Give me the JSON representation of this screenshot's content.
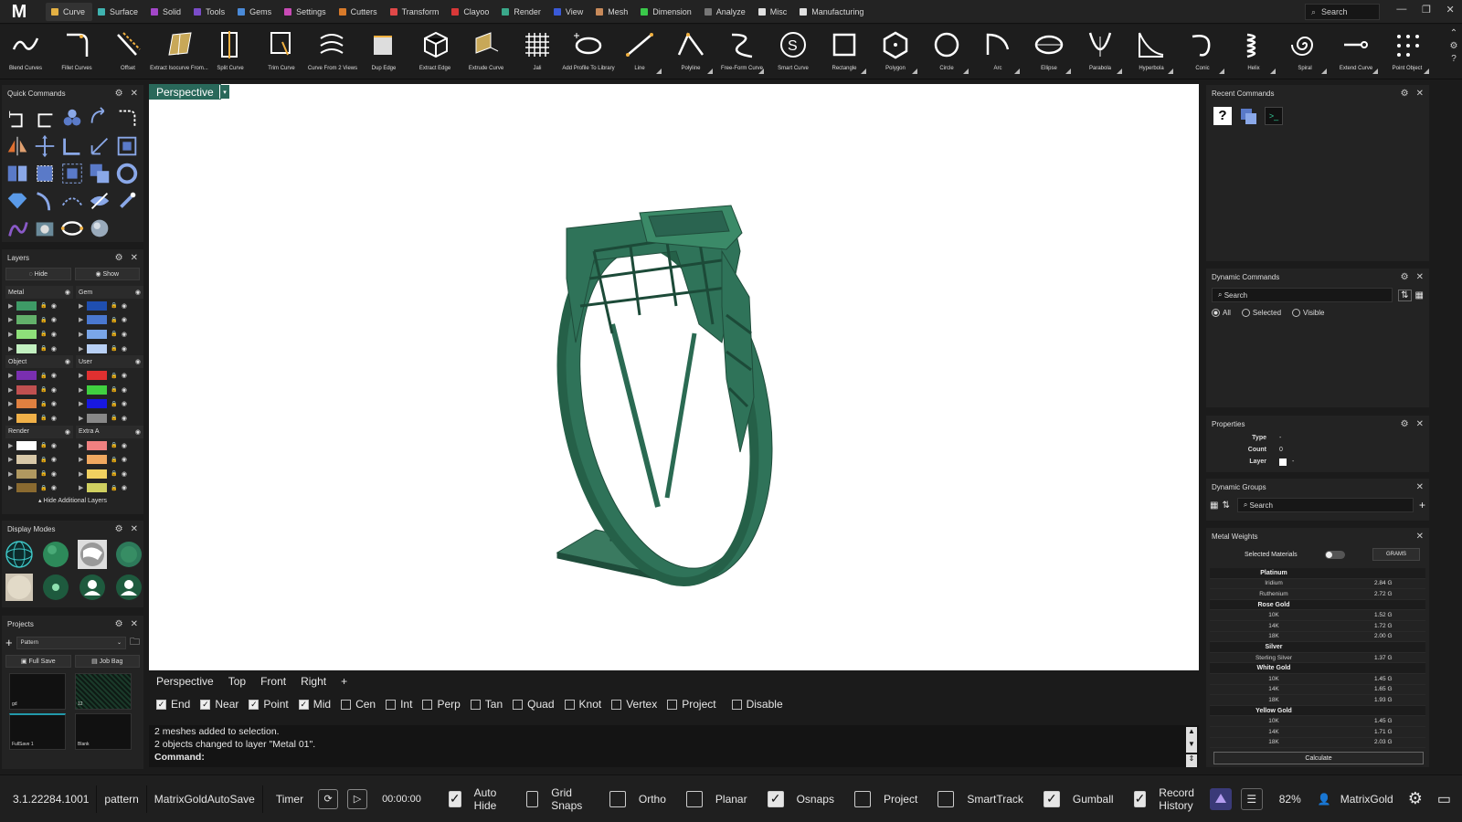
{
  "app": {
    "logo": "M"
  },
  "menu": {
    "tabs": [
      {
        "label": "Curve",
        "color": "#e3b043",
        "active": true
      },
      {
        "label": "Surface",
        "color": "#3fb3b0"
      },
      {
        "label": "Solid",
        "color": "#a347c8"
      },
      {
        "label": "Tools",
        "color": "#7a4cc8"
      },
      {
        "label": "Gems",
        "color": "#4a8ad8"
      },
      {
        "label": "Settings",
        "color": "#c84ab5"
      },
      {
        "label": "Cutters",
        "color": "#d87a2a"
      },
      {
        "label": "Transform",
        "color": "#e04848"
      },
      {
        "label": "Clayoo",
        "color": "#d83838"
      },
      {
        "label": "Render",
        "color": "#3aa88a"
      },
      {
        "label": "View",
        "color": "#3a5ad8"
      },
      {
        "label": "Mesh",
        "color": "#c88a5a"
      },
      {
        "label": "Dimension",
        "color": "#3ac84a"
      },
      {
        "label": "Analyze",
        "color": "#777777"
      },
      {
        "label": "Misc",
        "color": "#e0e0e0"
      },
      {
        "label": "Manufacturing",
        "color": "#e0e0e0"
      }
    ],
    "search_placeholder": "Search"
  },
  "toolbar": {
    "tools": [
      {
        "label": "Blend Curves",
        "icon": "blend-curves-icon",
        "dropdown": false
      },
      {
        "label": "Fillet Curves",
        "icon": "fillet-curves-icon",
        "dropdown": false
      },
      {
        "label": "Offset",
        "icon": "offset-icon",
        "dropdown": false
      },
      {
        "label": "Extract Isocurve From...",
        "icon": "extract-isocurve-icon",
        "dropdown": false
      },
      {
        "label": "Split Curve",
        "icon": "split-curve-icon",
        "dropdown": false
      },
      {
        "label": "Trim Curve",
        "icon": "trim-curve-icon",
        "dropdown": false
      },
      {
        "label": "Curve From 2 Views",
        "icon": "curve-from-2-views-icon",
        "dropdown": false
      },
      {
        "label": "Dup Edge",
        "icon": "dup-edge-icon",
        "dropdown": false
      },
      {
        "label": "Extract Edge",
        "icon": "extract-edge-icon",
        "dropdown": false
      },
      {
        "label": "Extrude Curve",
        "icon": "extrude-curve-icon",
        "dropdown": false
      },
      {
        "label": "Jali",
        "icon": "jali-icon",
        "dropdown": false
      },
      {
        "label": "Add Profile To Library",
        "icon": "add-profile-icon",
        "dropdown": false
      },
      {
        "label": "Line",
        "icon": "line-icon",
        "dropdown": true
      },
      {
        "label": "Polyline",
        "icon": "polyline-icon",
        "dropdown": true
      },
      {
        "label": "Free-Form Curve",
        "icon": "free-form-curve-icon",
        "dropdown": true
      },
      {
        "label": "Smart Curve",
        "icon": "smart-curve-icon",
        "dropdown": false
      },
      {
        "label": "Rectangle",
        "icon": "rectangle-icon",
        "dropdown": true
      },
      {
        "label": "Polygon",
        "icon": "polygon-icon",
        "dropdown": true
      },
      {
        "label": "Circle",
        "icon": "circle-icon",
        "dropdown": true
      },
      {
        "label": "Arc",
        "icon": "arc-icon",
        "dropdown": true
      },
      {
        "label": "Ellipse",
        "icon": "ellipse-icon",
        "dropdown": true
      },
      {
        "label": "Parabola",
        "icon": "parabola-icon",
        "dropdown": true
      },
      {
        "label": "Hyperbola",
        "icon": "hyperbola-icon",
        "dropdown": true
      },
      {
        "label": "Conic",
        "icon": "conic-icon",
        "dropdown": true
      },
      {
        "label": "Helix",
        "icon": "helix-icon",
        "dropdown": true
      },
      {
        "label": "Spiral",
        "icon": "spiral-icon",
        "dropdown": true
      },
      {
        "label": "Extend Curve",
        "icon": "extend-curve-icon",
        "dropdown": true
      },
      {
        "label": "Point Object",
        "icon": "point-object-icon",
        "dropdown": true
      }
    ]
  },
  "panels": {
    "quick_commands": {
      "title": "Quick Commands"
    },
    "layers": {
      "title": "Layers",
      "hide_label": "Hide",
      "show_label": "Show",
      "hide_additional": "Hide Additional Layers",
      "groups": [
        {
          "name": "Metal",
          "colors": [
            "#3e9a66",
            "#62b06a",
            "#8ee07a",
            "#c2f0c0"
          ]
        },
        {
          "name": "Gem",
          "colors": [
            "#1f4fb0",
            "#4a78d0",
            "#7aa6e8",
            "#b8d0f5"
          ]
        },
        {
          "name": "Object",
          "colors": [
            "#7a2fb0",
            "#c05050",
            "#e08040",
            "#f0b048"
          ]
        },
        {
          "name": "User",
          "colors": [
            "#e03030",
            "#40d040",
            "#1818e0",
            "#888888"
          ]
        },
        {
          "name": "Render",
          "colors": [
            "#ffffff",
            "#d8c8a8",
            "#b09860",
            "#8a6a30"
          ]
        },
        {
          "name": "Extra A",
          "colors": [
            "#f08080",
            "#f0a860",
            "#f0d060",
            "#d0d060"
          ]
        }
      ]
    },
    "display_modes": {
      "title": "Display Modes"
    },
    "projects": {
      "title": "Projects",
      "selected": "Pattern",
      "full_save": "Full Save",
      "job_bag": "Job Bag",
      "thumbs": [
        "gd",
        "12",
        "FullSave 1",
        "Blank"
      ]
    },
    "recent": {
      "title": "Recent Commands"
    },
    "dynamic_commands": {
      "title": "Dynamic Commands",
      "search": "Search",
      "filters": [
        {
          "label": "All",
          "on": true
        },
        {
          "label": "Selected",
          "on": false
        },
        {
          "label": "Visible",
          "on": false
        }
      ]
    },
    "properties": {
      "title": "Properties",
      "rows": [
        {
          "k": "Type",
          "v": "-"
        },
        {
          "k": "Count",
          "v": "0"
        },
        {
          "k": "Layer",
          "v": "-"
        }
      ]
    },
    "dynamic_groups": {
      "title": "Dynamic Groups",
      "search": "Search"
    },
    "metal_weights": {
      "title": "Metal Weights",
      "selected_materials": "Selected Materials",
      "unit": "GRAMS",
      "calculate": "Calculate",
      "rows": [
        {
          "n": "Platinum",
          "v": "",
          "h": true
        },
        {
          "n": "Iridium",
          "v": "2.84 G"
        },
        {
          "n": "Ruthenium",
          "v": "2.72 G"
        },
        {
          "n": "Rose Gold",
          "v": "",
          "h": true
        },
        {
          "n": "10K",
          "v": "1.52 G"
        },
        {
          "n": "14K",
          "v": "1.72 G"
        },
        {
          "n": "18K",
          "v": "2.00 G"
        },
        {
          "n": "Silver",
          "v": "",
          "h": true
        },
        {
          "n": "Sterling Silver",
          "v": "1.37 G"
        },
        {
          "n": "White Gold",
          "v": "",
          "h": true
        },
        {
          "n": "10K",
          "v": "1.45 G"
        },
        {
          "n": "14K",
          "v": "1.65 G"
        },
        {
          "n": "18K",
          "v": "1.93 G"
        },
        {
          "n": "Yellow Gold",
          "v": "",
          "h": true
        },
        {
          "n": "10K",
          "v": "1.45 G"
        },
        {
          "n": "14K",
          "v": "1.71 G"
        },
        {
          "n": "18K",
          "v": "2.03 G"
        }
      ]
    }
  },
  "viewport": {
    "label": "Perspective",
    "color": "#29685a",
    "model_color": "#2e6e55"
  },
  "view_tabs": [
    "Perspective",
    "Top",
    "Front",
    "Right",
    "+"
  ],
  "snaps": [
    {
      "label": "End",
      "on": true
    },
    {
      "label": "Near",
      "on": true
    },
    {
      "label": "Point",
      "on": true
    },
    {
      "label": "Mid",
      "on": true
    },
    {
      "label": "Cen",
      "on": false
    },
    {
      "label": "Int",
      "on": false
    },
    {
      "label": "Perp",
      "on": false
    },
    {
      "label": "Tan",
      "on": false
    },
    {
      "label": "Quad",
      "on": false
    },
    {
      "label": "Knot",
      "on": false
    },
    {
      "label": "Vertex",
      "on": false
    },
    {
      "label": "Project",
      "on": false
    },
    {
      "label": "Disable",
      "on": false
    }
  ],
  "command": {
    "history": [
      "2 meshes added to selection.",
      "2 objects changed to layer \"Metal 01\"."
    ],
    "prompt": "Command:"
  },
  "status": {
    "version": "3.1.22284.1001",
    "project": "pattern",
    "autosave": "MatrixGoldAutoSave",
    "timer_label": "Timer",
    "timer": "00:00:00",
    "toggles": [
      {
        "label": "Auto Hide",
        "on": true
      },
      {
        "label": "Grid Snaps",
        "on": false
      },
      {
        "label": "Ortho",
        "on": false
      },
      {
        "label": "Planar",
        "on": false
      },
      {
        "label": "Osnaps",
        "on": true
      },
      {
        "label": "Project",
        "on": false
      },
      {
        "label": "SmartTrack",
        "on": false
      },
      {
        "label": "Gumball",
        "on": true
      },
      {
        "label": "Record History",
        "on": true
      }
    ],
    "zoom": "82%",
    "user": "MatrixGold"
  }
}
